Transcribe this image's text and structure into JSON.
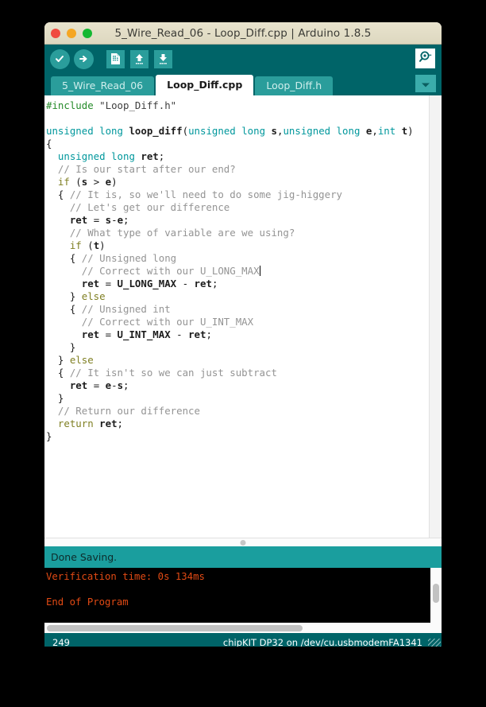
{
  "window": {
    "title": "5_Wire_Read_06 - Loop_Diff.cpp | Arduino 1.8.5",
    "traffic_lights": [
      "close",
      "minimize",
      "maximize"
    ],
    "accent_teal": "#006468",
    "tab_teal": "#2a9d9b",
    "status_teal": "#1a9e9e",
    "console_text_color": "#e24a14"
  },
  "toolbar": {
    "verify_label": "Verify",
    "upload_label": "Upload",
    "new_label": "New",
    "open_label": "Open",
    "save_label": "Save",
    "serial_monitor_label": "Serial Monitor"
  },
  "tabs": [
    {
      "label": "5_Wire_Read_06",
      "active": false
    },
    {
      "label": "Loop_Diff.cpp",
      "active": true
    },
    {
      "label": "Loop_Diff.h",
      "active": false
    }
  ],
  "tab_menu": {
    "icon": "chevron-down-icon"
  },
  "editor": {
    "language": "cpp",
    "caret_after": "U_LONG_MAX",
    "code_lines": [
      "#include \"Loop_Diff.h\"",
      "",
      "unsigned long loop_diff(unsigned long s,unsigned long e,int t)",
      "{",
      "  unsigned long ret;",
      "  // Is our start after our end?",
      "  if (s > e)",
      "  { // It is, so we'll need to do some jig-higgery",
      "    // Let's get our difference",
      "    ret = s-e;",
      "    // What type of variable are we using?",
      "    if (t)",
      "    { // Unsigned long",
      "      // Correct with our U_LONG_MAX",
      "      ret = U_LONG_MAX - ret;",
      "    } else",
      "    { // Unsigned int",
      "      // Correct with our U_INT_MAX",
      "      ret = U_INT_MAX - ret;",
      "    }",
      "  } else",
      "  { // It isn't so we can just subtract",
      "    ret = e-s;",
      "  }",
      "  // Return our difference",
      "  return ret;",
      "}"
    ]
  },
  "status": {
    "message": "Done Saving."
  },
  "console": {
    "lines": [
      "Verification time: 0s 134ms",
      "",
      "End of Program"
    ]
  },
  "bottombar": {
    "line_number": "249",
    "board": "chipKIT DP32 on /dev/cu.usbmodemFA1341"
  }
}
